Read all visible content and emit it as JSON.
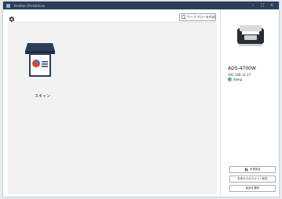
{
  "window": {
    "title": "Brother iPrint&Scan",
    "controls": {
      "minimize": "–",
      "maximize": "□",
      "close": "×"
    }
  },
  "toolbar": {
    "settings_icon": "gear-icon",
    "workflow_button_label": "ワークフローを作成"
  },
  "main": {
    "scan_tile_label": "スキャン",
    "scan_tile_icon": "scanner-document-icon"
  },
  "device": {
    "model": "ADS-4700W",
    "ip": "192.168.11.17",
    "status": "Sleep",
    "status_color": "#3aa55d"
  },
  "panel_buttons": {
    "machine_settings": "本体設定",
    "scan_to_pc_settings": "本体からのスキャン設定",
    "select_device": "製品を選択"
  },
  "colors": {
    "titlebar": "#2c3e58",
    "accent": "#2c3e58"
  }
}
